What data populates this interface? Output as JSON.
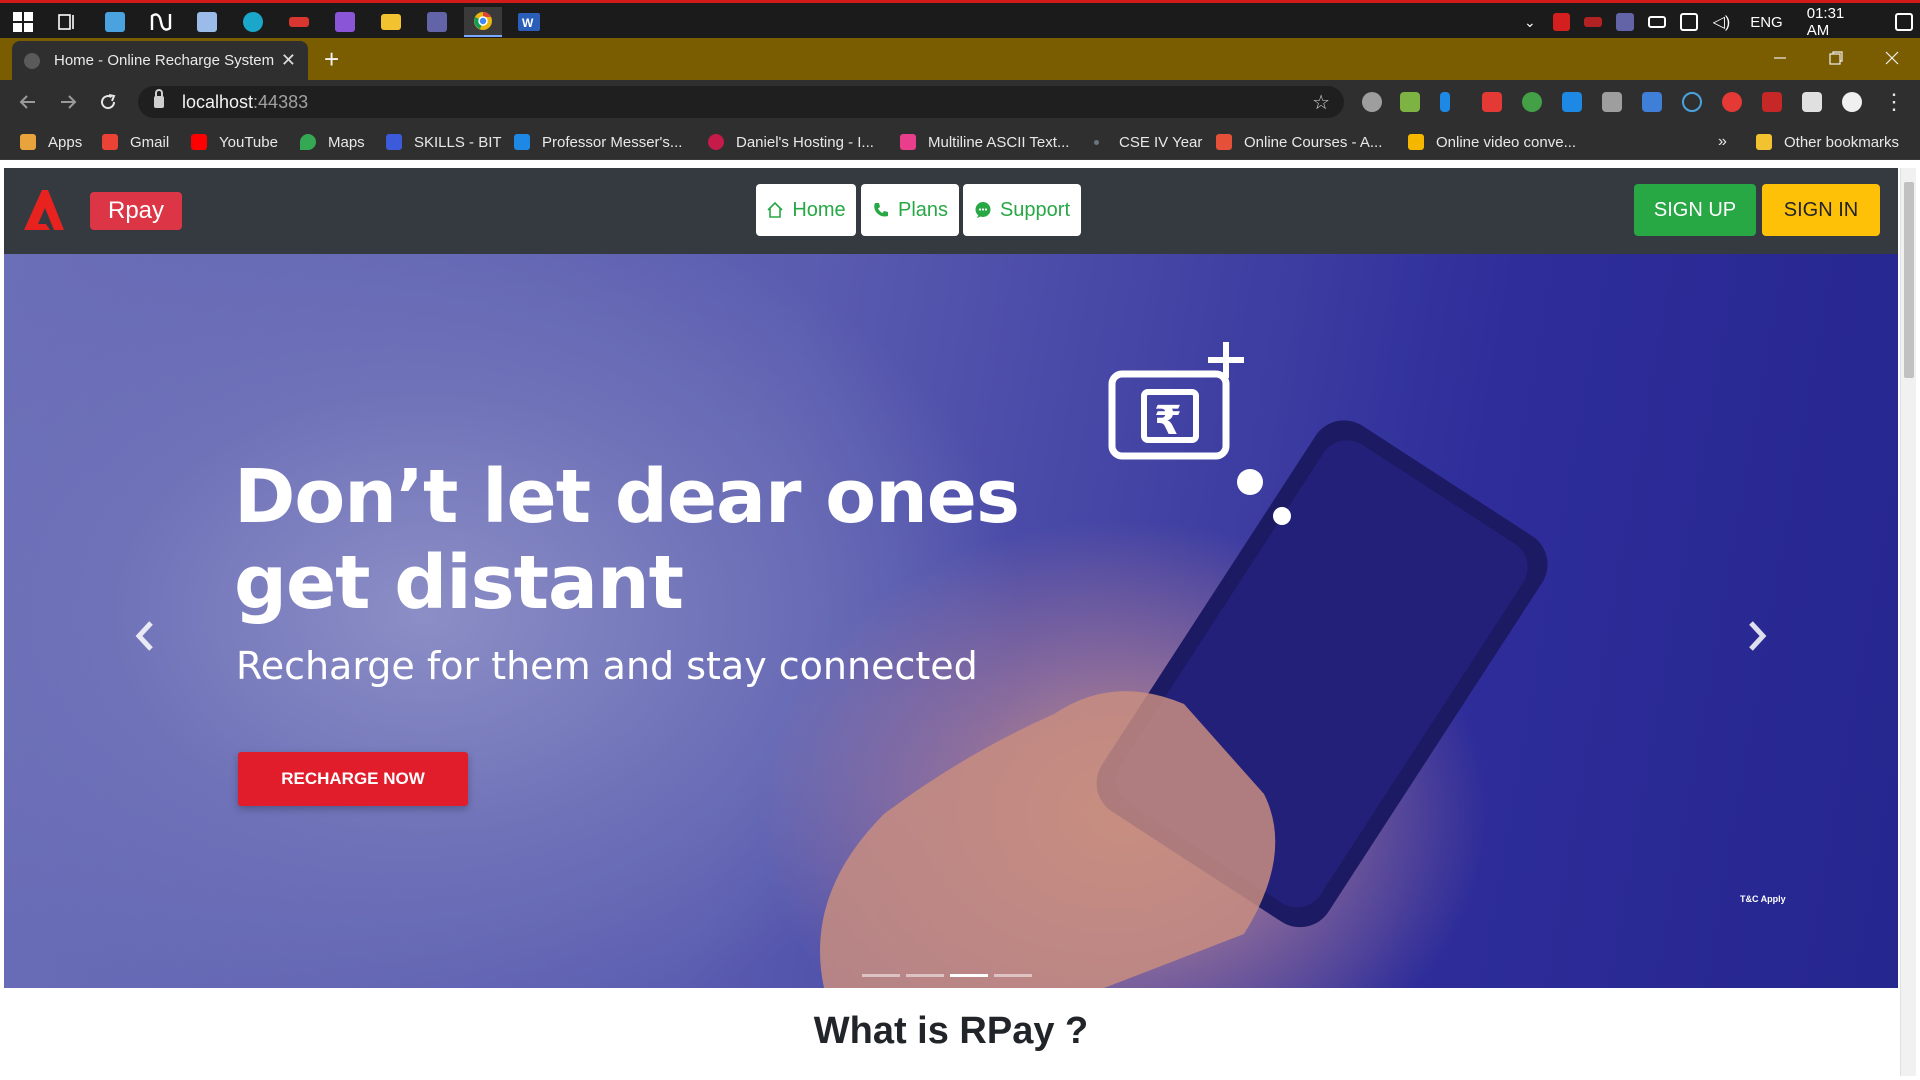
{
  "taskbar": {
    "pinned": [
      {
        "icon": "windows-start-icon",
        "color": "#ffffff"
      },
      {
        "icon": "task-view-icon",
        "color": "#ffffff"
      },
      {
        "icon": "app-icon",
        "color": "#4aa3df"
      },
      {
        "icon": "n-app-icon",
        "color": "#ffffff"
      },
      {
        "icon": "photos-icon",
        "color": "#9bbce8"
      },
      {
        "icon": "edge-icon",
        "color": "#1aa7c9"
      },
      {
        "icon": "app-red-icon",
        "color": "#d9362f"
      },
      {
        "icon": "visual-studio-icon",
        "color": "#8a55d6"
      },
      {
        "icon": "file-explorer-icon",
        "color": "#f2c230"
      },
      {
        "icon": "teams-icon",
        "color": "#6264a7"
      },
      {
        "icon": "chrome-icon",
        "color": "#e9b50f"
      },
      {
        "icon": "word-icon",
        "color": "#2b5eb8"
      }
    ],
    "language": "ENG",
    "time": "01:31 AM"
  },
  "browser": {
    "tab_title": "Home - Online Recharge System",
    "url_host": "localhost",
    "url_port": ":44383",
    "bookmarks": [
      {
        "label": "Apps",
        "icon": "apps-grid-icon",
        "color": "#e8a33d"
      },
      {
        "label": "Gmail",
        "icon": "gmail-icon",
        "color": "#ea4335"
      },
      {
        "label": "YouTube",
        "icon": "youtube-icon",
        "color": "#ff0000"
      },
      {
        "label": "Maps",
        "icon": "maps-icon",
        "color": "#34a853"
      },
      {
        "label": "SKILLS - BIT",
        "icon": "skills-icon",
        "color": "#3b5bdb"
      },
      {
        "label": "Professor Messer's...",
        "icon": "professor-messer-icon",
        "color": "#1e88e5"
      },
      {
        "label": "Daniel's Hosting - I...",
        "icon": "raspberry-icon",
        "color": "#c51a4a"
      },
      {
        "label": "Multiline ASCII Text...",
        "icon": "ascii-icon",
        "color": "#e83e8c"
      },
      {
        "label": "CSE IV Year",
        "icon": "dot-icon",
        "color": "#6c757d"
      },
      {
        "label": "Online Courses - A...",
        "icon": "courses-icon",
        "color": "#e55039"
      },
      {
        "label": "Online video conve...",
        "icon": "video-converter-icon",
        "color": "#f5b700"
      }
    ],
    "other_bookmarks": "Other bookmarks",
    "overflow": "»"
  },
  "site": {
    "brand": "Rpay",
    "nav": {
      "home": "Home",
      "plans": "Plans",
      "support": "Support"
    },
    "sign_up": "SIGN UP",
    "sign_in": "SIGN IN",
    "hero": {
      "title_line1": "Don’t let dear ones",
      "title_line2": "get distant",
      "subtitle": "Recharge for them and stay connected",
      "cta": "RECHARGE NOW",
      "terms": "T&C Apply",
      "slide_count": 4,
      "active_slide": 3
    },
    "section_title": "What is RPay ?",
    "colors": {
      "brand_red": "#dc3545",
      "nav_bg": "#343a40",
      "green": "#28a745",
      "yellow": "#ffc107"
    }
  }
}
